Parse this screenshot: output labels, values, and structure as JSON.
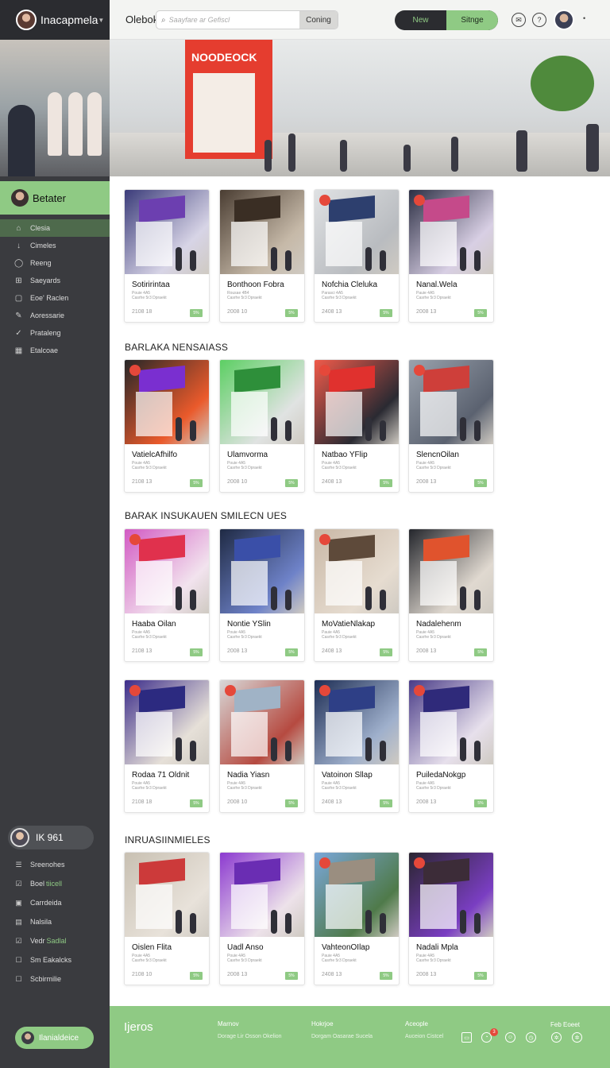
{
  "app": {
    "name": "Inacapmela"
  },
  "sidebar": {
    "header": "Betater",
    "items": [
      {
        "label": "Clesia",
        "icon": "home-icon",
        "active": true
      },
      {
        "label": "Cimeles",
        "icon": "download-icon"
      },
      {
        "label": "Reeng",
        "icon": "ring-icon"
      },
      {
        "label": "Saeyards",
        "icon": "yard-icon"
      },
      {
        "label": "Eoe' Raclen",
        "icon": "folder-icon"
      },
      {
        "label": "Aoressarie",
        "icon": "edit-icon"
      },
      {
        "label": "Prataleng",
        "icon": "check-icon"
      },
      {
        "label": "Etalcoae",
        "icon": "grid-icon"
      }
    ],
    "user": {
      "name": "IK 961"
    },
    "items2": [
      {
        "label": "Sreenohes",
        "icon": "list-icon"
      },
      {
        "label": "Boel",
        "accent": "tiicell",
        "icon": "check-box-icon"
      },
      {
        "label": "Carrdeida",
        "icon": "card-icon"
      },
      {
        "label": "Nalsila",
        "icon": "page-icon"
      },
      {
        "label": "Vedr",
        "accent": "Sadlal",
        "icon": "check-box-icon"
      },
      {
        "label": "Sm Eakalcks",
        "icon": "box-icon"
      },
      {
        "label": "Scbirmilie",
        "icon": "box-icon"
      }
    ],
    "cta": "Ilanialdeice"
  },
  "topbar": {
    "crumb": "Olebok",
    "search_placeholder": "Saayfare ar Gefiscl",
    "search_button": "Coning",
    "toggle": [
      "New",
      "Sitnge"
    ],
    "icons": [
      "message-icon",
      "help-icon",
      "avatar-icon",
      "more-icon"
    ]
  },
  "sections": [
    {
      "title": "",
      "cards": [
        {
          "title": "Sotiririntaa",
          "sub1": "Pouie 4A5",
          "sub2": "Casrhe 5r3 Dpraekt",
          "price": "2108 18",
          "tag": "5%",
          "badge": false,
          "c1": "#3b3c7a",
          "c2": "#d7d4e6",
          "sign": "#6c3fb0"
        },
        {
          "title": "Bonthoon Fobra",
          "sub1": "Rousae 4B4",
          "sub2": "Casrhe 5r3 Dpraekt",
          "price": "2008 10",
          "tag": "5%",
          "badge": false,
          "c1": "#4a3d32",
          "c2": "#c6b9a8",
          "sign": "#3a2e24"
        },
        {
          "title": "Nofchia Cleluka",
          "sub1": "Parasci 4A5",
          "sub2": "Casrhe 5r3 Dpraekt",
          "price": "2408 13",
          "tag": "5%",
          "badge": true,
          "c1": "#dfe1e3",
          "c2": "#b9bcc0",
          "sign": "#2d3f6e"
        },
        {
          "title": "Nanal.Wela",
          "sub1": "Pauie 4A5",
          "sub2": "Casrhe 5r3 Dpraekt",
          "price": "2008 13",
          "tag": "5%",
          "badge": true,
          "c1": "#2c2f44",
          "c2": "#d8cfe4",
          "sign": "#c54a8a"
        }
      ]
    },
    {
      "title": "BARLAKA NENSAIASS",
      "cards": [
        {
          "title": "VatielcAfhilfo",
          "sub1": "Pouie 4A5",
          "sub2": "Casrhe 5r3 Dpraekt",
          "price": "2108 13",
          "tag": "5%",
          "badge": true,
          "c1": "#262628",
          "c2": "#ea5a2b",
          "sign": "#7a2fd0"
        },
        {
          "title": "Ulamvorma",
          "sub1": "Pouie 4A5",
          "sub2": "Casrhe 5r3 Dpraekt",
          "price": "2008 10",
          "tag": "5%",
          "badge": false,
          "c1": "#5ccf63",
          "c2": "#e0e3e2",
          "sign": "#2e8f3a"
        },
        {
          "title": "Natbao YFlip",
          "sub1": "Pouie 4A5",
          "sub2": "Casrhe 5r3 Dpraekt",
          "price": "2408 13",
          "tag": "5%",
          "badge": true,
          "c1": "#f05a4a",
          "c2": "#2a2a32",
          "sign": "#e0312e"
        },
        {
          "title": "SlencnOilan",
          "sub1": "Pauie 4A5",
          "sub2": "Casrhe 5r3 Dpraekt",
          "price": "2008 13",
          "tag": "5%",
          "badge": true,
          "c1": "#9aa2ad",
          "c2": "#5b6270",
          "sign": "#ce3f3a"
        }
      ]
    },
    {
      "title": "BARAK INSUKAUEN SMILECN UES",
      "cards": [
        {
          "title": "Haaba Oilan",
          "sub1": "Pouie 4A5",
          "sub2": "Casrhe 5r3 Dpraekt",
          "price": "2108 13",
          "tag": "5%",
          "badge": true,
          "c1": "#d25ac3",
          "c2": "#f2e3ee",
          "sign": "#e0314d"
        },
        {
          "title": "Nontie YSlin",
          "sub1": "Pouie 4A5",
          "sub2": "Casrhe 5r3 Dpraekt",
          "price": "2008 13",
          "tag": "5%",
          "badge": false,
          "c1": "#1f2a44",
          "c2": "#6e82c8",
          "sign": "#3a4fa8"
        },
        {
          "title": "MoVatieNlakap",
          "sub1": "Pauie 4A5",
          "sub2": "Casrhe 5r3 Dpraekt",
          "price": "2408 13",
          "tag": "5%",
          "badge": true,
          "c1": "#c9b8a6",
          "c2": "#e6dcd0",
          "sign": "#5e4a3a"
        },
        {
          "title": "Nadalehenm",
          "sub1": "Pauie 4A5",
          "sub2": "Casrhe 5r3 Dpraekt",
          "price": "2008 13",
          "tag": "5%",
          "badge": false,
          "c1": "#24262c",
          "c2": "#e0d9d0",
          "sign": "#e0532d"
        }
      ]
    },
    {
      "title": "",
      "cards": [
        {
          "title": "Rodaa 71 Oldnit",
          "sub1": "Pouie 4A5",
          "sub2": "Casrhe 5r3 Dpraekt",
          "price": "2108 18",
          "tag": "5%",
          "badge": true,
          "c1": "#3c2d8a",
          "c2": "#e6e0d8",
          "sign": "#2c2a80"
        },
        {
          "title": "Nadia Yiasn",
          "sub1": "Pouie 4A5",
          "sub2": "Casrhe 5r3 Dpraekt",
          "price": "2008 10",
          "tag": "5%",
          "badge": true,
          "c1": "#d8d8d8",
          "c2": "#b64a40",
          "sign": "#a0b3c6"
        },
        {
          "title": "Vatoinon Sllap",
          "sub1": "Pauie 4A5",
          "sub2": "Casrhe 5r3 Dpraekt",
          "price": "2408 13",
          "tag": "5%",
          "badge": true,
          "c1": "#1e2e55",
          "c2": "#9fb0cc",
          "sign": "#2e3f86"
        },
        {
          "title": "PuiledaNokgp",
          "sub1": "Pauie 4A5",
          "sub2": "Casrhe 5r3 Dpraekt",
          "price": "2008 13",
          "tag": "5%",
          "badge": true,
          "c1": "#4a3c88",
          "c2": "#e7e0ec",
          "sign": "#2f2a7a"
        }
      ]
    },
    {
      "title": "INRUASIINMIELES",
      "cards": [
        {
          "title": "Oislen Flita",
          "sub1": "Pouie 4A5",
          "sub2": "Casrhe 5r3 Dpraekt",
          "price": "2108 10",
          "tag": "5%",
          "badge": false,
          "c1": "#c8c0b2",
          "c2": "#e8e2da",
          "sign": "#cc3a3a"
        },
        {
          "title": "Uadl Anso",
          "sub1": "Pouie 4A5",
          "sub2": "Casrhe 5r3 Dpraekt",
          "price": "2008 13",
          "tag": "5%",
          "badge": false,
          "c1": "#8c3ad0",
          "c2": "#ede2ea",
          "sign": "#6a2db3"
        },
        {
          "title": "VahteonOIlap",
          "sub1": "Pauie 4A5",
          "sub2": "Casrhe 5r3 Dpraekt",
          "price": "2408 13",
          "tag": "5%",
          "badge": true,
          "c1": "#7aa7d8",
          "c2": "#4f7a4a",
          "sign": "#9a8e80"
        },
        {
          "title": "Nadali Mpla",
          "sub1": "Pauie 4A5",
          "sub2": "Casrhe 5r3 Dpraekt",
          "price": "2008 13",
          "tag": "5%",
          "badge": true,
          "c1": "#2a2530",
          "c2": "#7a3ec2",
          "sign": "#3c2c38"
        }
      ]
    }
  ],
  "footer": {
    "logo": "Ijeros",
    "columns": [
      {
        "title": "Marnov",
        "sub": "Dorage Lir Osson Okelion"
      },
      {
        "title": "Hokrjoe",
        "sub": "Dorgam Oasarae Sucela"
      },
      {
        "title": "Aceople",
        "sub": "Auceion Cistcel"
      }
    ],
    "notif_count": "3",
    "right": "Feb Eoeet"
  }
}
